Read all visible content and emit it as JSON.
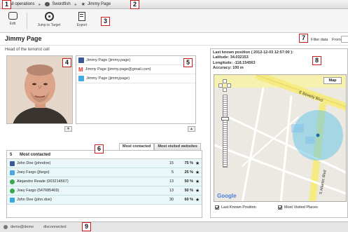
{
  "breadcrumb": {
    "items": [
      {
        "label": "All operations",
        "icon": "folder-icon"
      },
      {
        "label": "Swordfish",
        "icon": "target-icon"
      },
      {
        "label": "Jimmy Page",
        "icon": "star-icon"
      }
    ],
    "separator": "▸"
  },
  "toolbar": {
    "edit_label": "Edit",
    "jump_label": "Jump to Target",
    "export_label": "Export"
  },
  "target": {
    "name": "Jimmy Page",
    "description": "Head of the terrorist cell"
  },
  "filter": {
    "label": "Filter data",
    "from_label": "From:"
  },
  "identities": [
    {
      "label": "Jimmy Page (jimmy.page)",
      "icon": "facebook-icon",
      "color": "#3b5998"
    },
    {
      "label": "Jimmy Page (jimmy.page@gmail.com)",
      "icon": "gmail-icon",
      "color": "#d93025"
    },
    {
      "label": "Jimmy Page (jimmypage)",
      "icon": "twitter-icon",
      "color": "#4aa8e0"
    }
  ],
  "scroll": {
    "up": "▲",
    "down": "▼"
  },
  "tabs": [
    "Most contacted",
    "Most visited websites"
  ],
  "contacts": {
    "count": "5",
    "header": "Most contacted",
    "rows": [
      {
        "name": "John Doe (johndoe)",
        "count": "15",
        "percent": "75 %",
        "star": "★",
        "icon": "facebook-icon",
        "color": "#3b5998"
      },
      {
        "name": "Joey Fargo (jfargo)",
        "count": "5",
        "percent": "25 %",
        "star": "★",
        "icon": "twitter-icon",
        "color": "#4aa8e0"
      },
      {
        "name": "Alejandro Reade (003214567)",
        "count": "13",
        "percent": "50 %",
        "star": "★",
        "icon": "phone-icon",
        "color": "#3aa84c"
      },
      {
        "name": "Joey Fargo (547685469)",
        "count": "13",
        "percent": "50 %",
        "star": "★",
        "icon": "phone-icon",
        "color": "#3aa84c"
      },
      {
        "name": "John Doe (john.doe)",
        "count": "30",
        "percent": "60 %",
        "star": "★",
        "icon": "skype-icon",
        "color": "#35a9e0"
      }
    ]
  },
  "map": {
    "position_title": "Last known position ( 2012-12-03 12:57:00 ):",
    "latitude_label": "Latitude:",
    "latitude": "34.032153",
    "longitude_label": "Longitude:",
    "longitude": "-118.154563",
    "accuracy_label": "Accuracy:",
    "accuracy": "100 m",
    "map_button": "Map",
    "street_1": "E Beverly Blvd",
    "street_2": "S Atlantic Blvd",
    "attribution": "Google",
    "checkbox_last": "Last Known Position",
    "checkbox_visited": "Most Visited Places"
  },
  "status": {
    "user": "demo@demo",
    "connection": "disconnected"
  },
  "annotations": [
    "1",
    "2",
    "3",
    "4",
    "5",
    "6",
    "7",
    "8",
    "9"
  ]
}
